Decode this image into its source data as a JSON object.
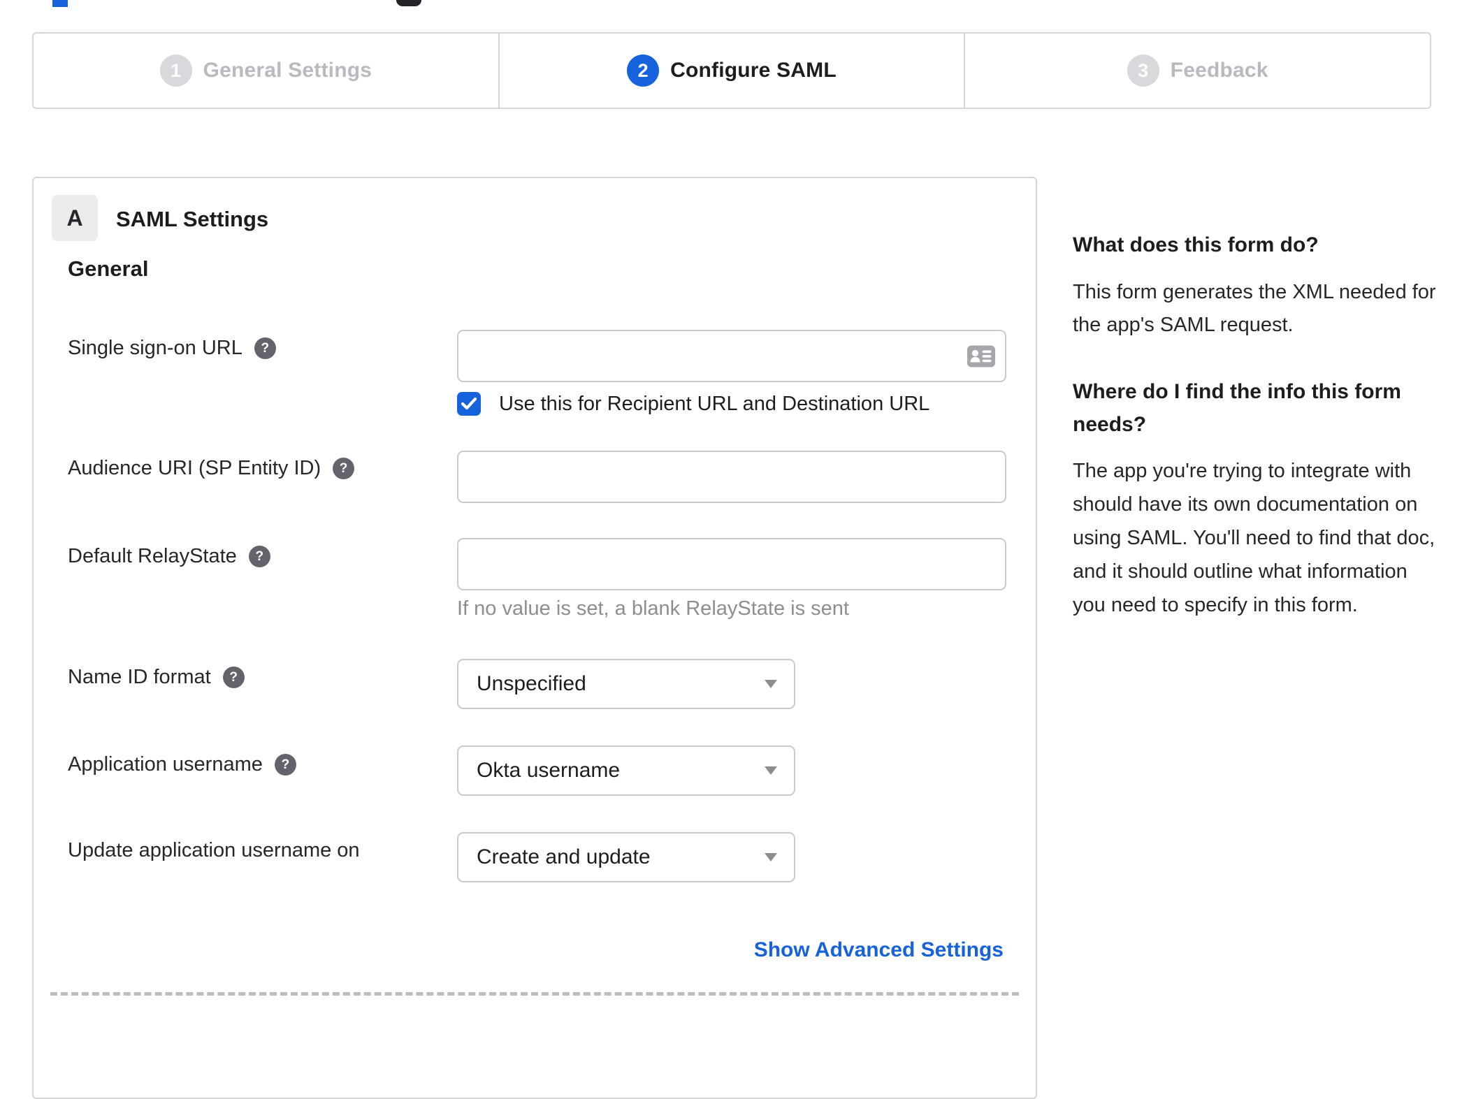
{
  "colors": {
    "accent_blue": "#1662dd",
    "text": "#1d1d21",
    "inactive_gray": "#b9b9c0",
    "hint_gray": "#8d8d93",
    "border_gray": "#d6d6da"
  },
  "ui": {
    "help_glyph": "?"
  },
  "stepper": {
    "steps": [
      {
        "number": "1",
        "label": "General Settings",
        "state": "inactive"
      },
      {
        "number": "2",
        "label": "Configure SAML",
        "state": "active"
      },
      {
        "number": "3",
        "label": "Feedback",
        "state": "inactive"
      }
    ]
  },
  "panel": {
    "section_badge": "A",
    "section_title": "SAML Settings",
    "group_heading": "General",
    "fields": [
      {
        "label": "Single sign-on URL",
        "has_help": true,
        "type": "text",
        "value": "",
        "checkbox_label": "Use this for Recipient URL and Destination URL",
        "checkbox_checked": true
      },
      {
        "label": "Audience URI (SP Entity ID)",
        "has_help": true,
        "type": "text",
        "value": ""
      },
      {
        "label": "Default RelayState",
        "has_help": true,
        "type": "text",
        "value": "",
        "hint": "If no value is set, a blank RelayState is sent"
      },
      {
        "label": "Name ID format",
        "has_help": true,
        "type": "select",
        "value": "Unspecified"
      },
      {
        "label": "Application username",
        "has_help": true,
        "type": "select",
        "value": "Okta username"
      },
      {
        "label": "Update application username on",
        "has_help": false,
        "type": "select",
        "value": "Create and update"
      }
    ],
    "advanced_link": "Show Advanced Settings"
  },
  "sidebar": {
    "sections": [
      {
        "heading": "What does this form do?",
        "body": "This form generates the XML needed for the app's SAML request."
      },
      {
        "heading": "Where do I find the info this form needs?",
        "body": "The app you're trying to integrate with should have its own documentation on using SAML. You'll need to find that doc, and it should outline what information you need to specify in this form."
      }
    ]
  }
}
